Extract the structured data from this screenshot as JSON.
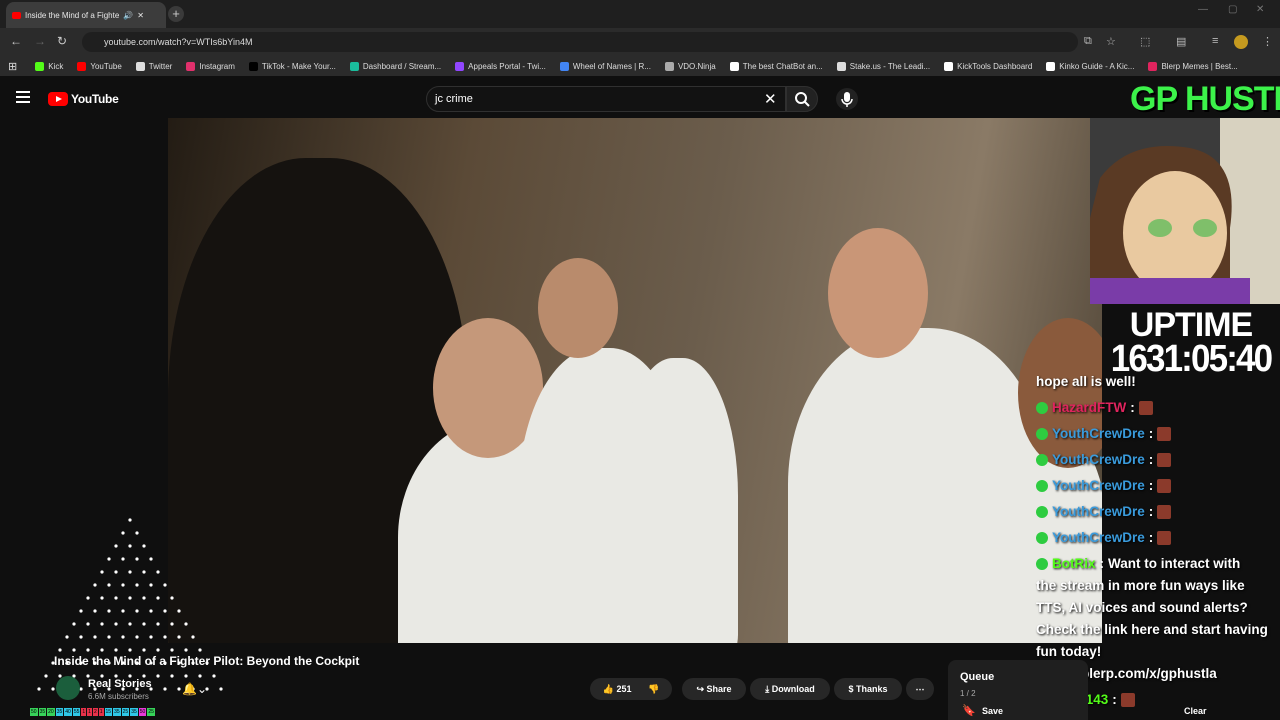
{
  "browser": {
    "tab_title": "Inside the Mind of a Fighte",
    "url": "youtube.com/watch?v=WTIs6bYin4M",
    "bookmarks": [
      {
        "label": "Kick",
        "color": "#53fc18"
      },
      {
        "label": "YouTube",
        "color": "#ff0000"
      },
      {
        "label": "Twitter",
        "color": "#dddddd"
      },
      {
        "label": "Instagram",
        "color": "#e1306c"
      },
      {
        "label": "TikTok - Make Your...",
        "color": "#000000"
      },
      {
        "label": "Dashboard / Stream...",
        "color": "#1abc9c"
      },
      {
        "label": "Appeals Portal - Twi...",
        "color": "#9146ff"
      },
      {
        "label": "Wheel of Names | R...",
        "color": "#4285f4"
      },
      {
        "label": "VDO.Ninja",
        "color": "#aaaaaa"
      },
      {
        "label": "The best ChatBot an...",
        "color": "#ffffff"
      },
      {
        "label": "Stake.us - The Leadi...",
        "color": "#dddddd"
      },
      {
        "label": "KickTools Dashboard",
        "color": "#ffffff"
      },
      {
        "label": "Kinko Guide - A Kic...",
        "color": "#ffffff"
      },
      {
        "label": "Blerp Memes | Best...",
        "color": "#e0245e"
      }
    ]
  },
  "youtube": {
    "logo_text": "YouTube",
    "search_value": "jc crime",
    "video_title": "Inside the Mind of a Fighter Pilot: Beyond the Cockpit",
    "channel_name": "Real Stories",
    "subscribers": "6.6M subscribers",
    "likes": "251",
    "share_label": "Share",
    "download_label": "Download",
    "thanks_label": "Thanks",
    "queue_title": "Queue",
    "queue_count": "1 / 2",
    "queue_save": "Save",
    "queue_clear": "Clear"
  },
  "stream_overlay": {
    "title": "GP HUSTLA",
    "uptime_label": "UPTIME",
    "uptime_value": "1631:05:40",
    "chat": [
      {
        "user": "",
        "text": "hope all is well!",
        "user_color": "#ffffff"
      },
      {
        "user": "HazardFTW",
        "text": "",
        "user_color": "#e0245e"
      },
      {
        "user": "YouthCrewDre",
        "text": "",
        "user_color": "#3a9bdc"
      },
      {
        "user": "YouthCrewDre",
        "text": "",
        "user_color": "#3a9bdc"
      },
      {
        "user": "YouthCrewDre",
        "text": "",
        "user_color": "#3a9bdc"
      },
      {
        "user": "YouthCrewDre",
        "text": "",
        "user_color": "#3a9bdc"
      },
      {
        "user": "YouthCrewDre",
        "text": "",
        "user_color": "#3a9bdc"
      },
      {
        "user": "BotRix",
        "text": "Want to interact with",
        "user_color": "#53fc18"
      },
      {
        "user": "",
        "text": "the stream in more fun ways like",
        "user_color": "#ffffff"
      },
      {
        "user": "",
        "text": "TTS, AI voices and sound alerts?",
        "user_color": "#ffffff"
      },
      {
        "user": "",
        "text": "Check the link here and start having",
        "user_color": "#ffffff"
      },
      {
        "user": "",
        "text": "fun today!",
        "user_color": "#ffffff"
      },
      {
        "user": "",
        "text": "https://blerp.com/x/gphustla",
        "user_color": "#ffffff"
      },
      {
        "user": "bbgrl143",
        "text": "",
        "user_color": "#53fc18"
      }
    ]
  },
  "counter_strip": [
    "50",
    "35",
    "20",
    "35",
    "40",
    "55",
    "1",
    "1",
    "2",
    "1",
    "15",
    "35",
    "25",
    "35",
    "50",
    "25"
  ]
}
